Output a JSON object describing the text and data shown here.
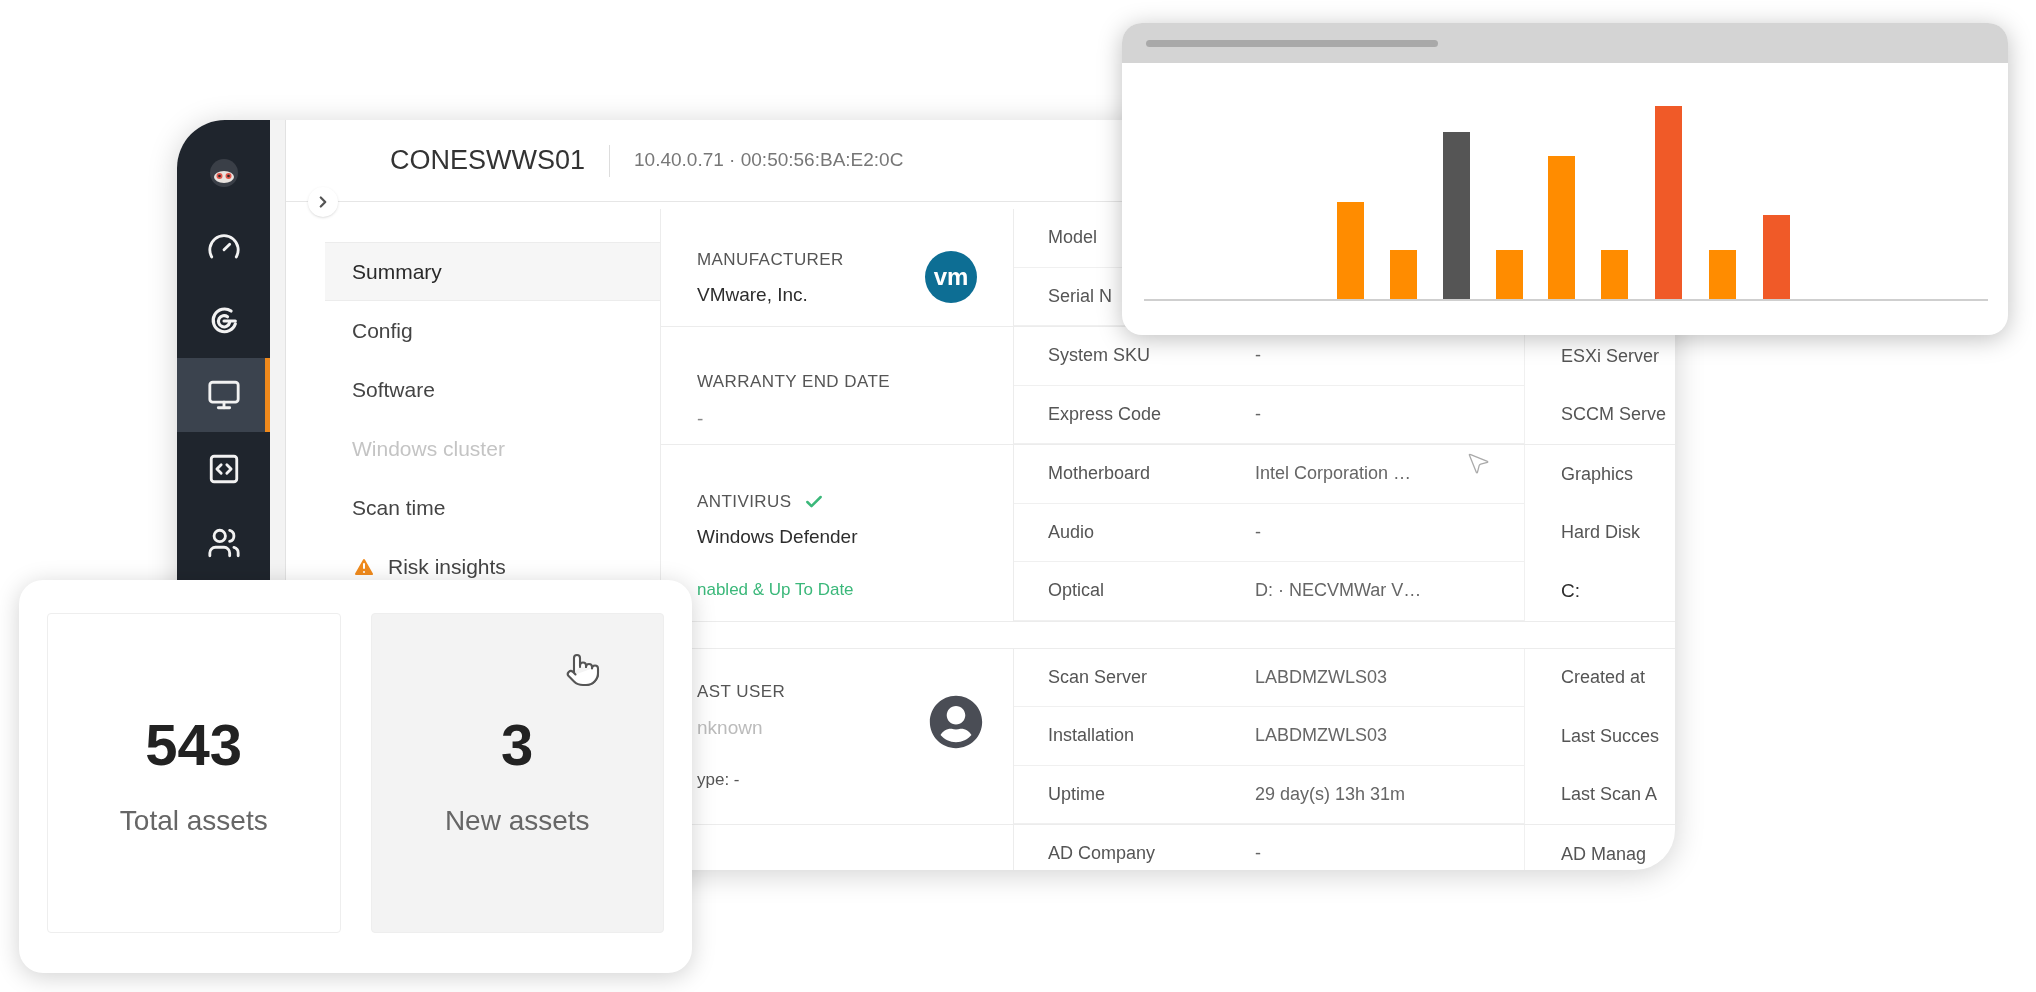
{
  "main_window": {
    "sidebar": {
      "items": [
        {
          "selected": false
        },
        {
          "selected": false
        },
        {
          "selected": true
        },
        {
          "selected": false
        },
        {
          "selected": false
        }
      ]
    },
    "header": {
      "title": "CONESWWS01",
      "address": "10.40.0.71 · 00:50:56:BA:E2:0C"
    },
    "menu": [
      {
        "label": "Summary",
        "selected": true,
        "disabled": false,
        "warning": false
      },
      {
        "label": "Config",
        "selected": false,
        "disabled": false,
        "warning": false
      },
      {
        "label": "Software",
        "selected": false,
        "disabled": false,
        "warning": false
      },
      {
        "label": "Windows cluster",
        "selected": false,
        "disabled": true,
        "warning": false
      },
      {
        "label": "Scan time",
        "selected": false,
        "disabled": false,
        "warning": false
      },
      {
        "label": "Risk insights",
        "selected": false,
        "disabled": false,
        "warning": true
      }
    ],
    "groups": [
      {
        "left": {
          "kind": "vendor",
          "title": "MANUFACTURER",
          "value": "VMware, Inc.",
          "logo_text": "vm"
        },
        "rows": [
          {
            "label": "Model"
          },
          {
            "label": "Serial N"
          }
        ]
      },
      {
        "left": {
          "kind": "plain",
          "title": "WARRANTY END DATE",
          "value": "-"
        },
        "rows": [
          {
            "label": "System SKU",
            "value": "-",
            "side": {
              "label": "ESXi Server"
            }
          },
          {
            "label": "Express Code",
            "value": "-",
            "side": {
              "label": "SCCM Serve"
            }
          }
        ]
      },
      {
        "left": {
          "kind": "status",
          "title": "ANTIVIRUS",
          "checked": true,
          "value": "Windows Defender",
          "status": "nabled & Up To Date"
        },
        "rows": [
          {
            "label": "Motherboard",
            "value": "Intel Corporation …",
            "side": {
              "label": "Graphics"
            }
          },
          {
            "label": "Audio",
            "value": "-",
            "side": {
              "label": "Hard Disk"
            }
          },
          {
            "label": "Optical",
            "value": "D: · NECVMWar V…",
            "side": {
              "value": "C:"
            }
          }
        ]
      },
      {
        "left": {
          "kind": "user",
          "title": "AST USER",
          "value": "nknown",
          "note": "ype: -"
        },
        "rows": [
          {
            "label": "Scan Server",
            "value": "LABDMZWLS03",
            "side": {
              "label": "Created at"
            }
          },
          {
            "label": "Installation",
            "value": "LABDMZWLS03",
            "side": {
              "label": "Last Succes"
            }
          },
          {
            "label": "Uptime",
            "value": "29 day(s) 13h 31m",
            "side": {
              "label": "Last Scan A"
            }
          }
        ]
      },
      {
        "left": {
          "kind": "empty"
        },
        "rows": [
          {
            "label": "AD Company",
            "value": "-",
            "side": {
              "label": "AD Manag"
            }
          }
        ]
      }
    ]
  },
  "stats_panel": {
    "cards": [
      {
        "value": "543",
        "label": "Total assets",
        "highlighted": false
      },
      {
        "value": "3",
        "label": "New assets",
        "highlighted": true
      }
    ]
  }
}
